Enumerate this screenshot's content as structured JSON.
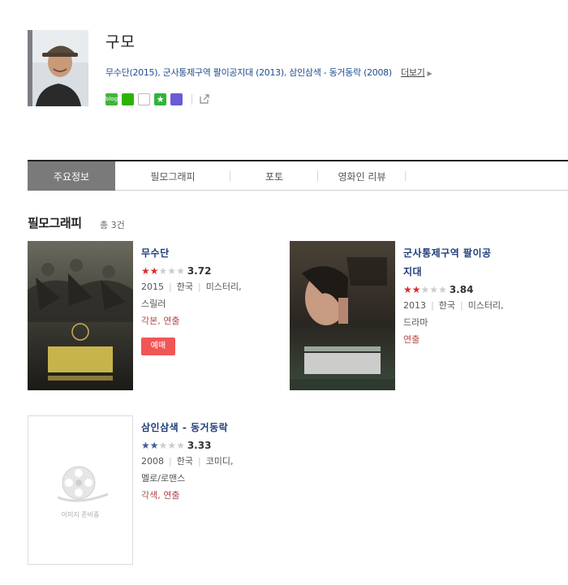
{
  "profile": {
    "name": "구모",
    "works": [
      {
        "title": "무수단",
        "year": "(2015)"
      },
      {
        "title": "군사통제구역 팔이공지대",
        "year": "(2013)"
      },
      {
        "title": "삼인삼색 - 동거동락",
        "year": "(2008)"
      }
    ],
    "separator": ",",
    "more_label": "더보기",
    "sns_icons": [
      "blog-icon",
      "cafe-icon",
      "me-icon",
      "favorite-star-icon",
      "band-icon",
      "share-icon"
    ],
    "blog_text": "blog"
  },
  "tabs": [
    {
      "label": "주요정보",
      "active": true
    },
    {
      "label": "필모그래피",
      "active": false
    },
    {
      "label": "포토",
      "active": false
    },
    {
      "label": "영화인 리뷰",
      "active": false
    }
  ],
  "filmography": {
    "title": "필모그래피",
    "count": "총 3건",
    "movies": [
      {
        "title": "무수단",
        "stars_filled": 2,
        "star_color": "#d92b2b",
        "score": "3.72",
        "year": "2015",
        "country": "한국",
        "genre_line1": "미스터리,",
        "genre_line2": "스릴러",
        "roles": "각본, 연출",
        "book_label": "예매"
      },
      {
        "title_line1": "군사통제구역 팔이공",
        "title_line2": "지대",
        "stars_filled": 2,
        "star_color": "#d92b2b",
        "score": "3.84",
        "year": "2013",
        "country": "한국",
        "genre_line1": "미스터리,",
        "genre_line2": "드라마",
        "roles": "연출"
      },
      {
        "title": "삼인삼색 - 동거동락",
        "stars_filled": 2,
        "star_color": "#3d5f94",
        "score": "3.33",
        "year": "2008",
        "country": "한국",
        "genre_line1": "코미디,",
        "genre_line2": "멜로/로맨스",
        "roles": "각색, 연출",
        "noimage_label": "이미지 준비중"
      }
    ]
  }
}
